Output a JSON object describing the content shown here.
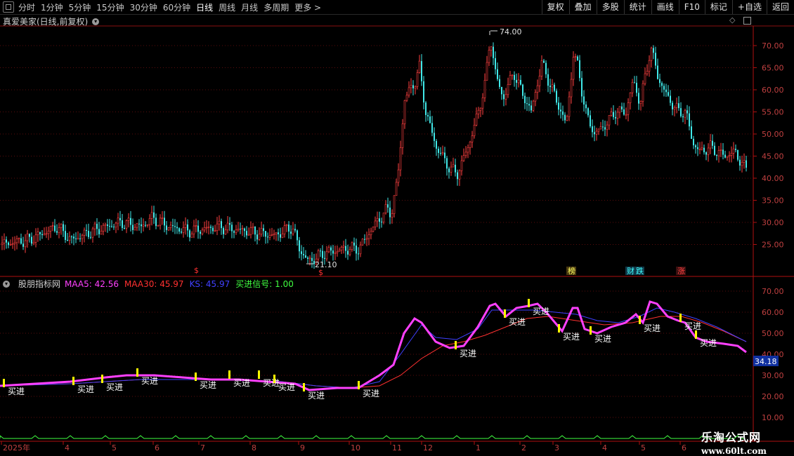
{
  "toolbar": {
    "periods": [
      "分时",
      "1分钟",
      "5分钟",
      "15分钟",
      "30分钟",
      "60分钟",
      "日线",
      "周线",
      "月线",
      "多周期",
      "更多 >"
    ],
    "active_period": "日线",
    "actions": [
      "复权",
      "叠加",
      "多股",
      "统计",
      "画线",
      "F10",
      "标记",
      "+自选",
      "返回"
    ]
  },
  "chart": {
    "title": "真爱美家(日线,前复权)",
    "high_label": "74.00",
    "low_label": "21.10",
    "price_ticks": [
      "70.00",
      "65.00",
      "60.00",
      "55.00",
      "50.00",
      "45.00",
      "40.00",
      "35.00",
      "30.00",
      "25.00"
    ],
    "badges": [
      "$",
      "$",
      "榜",
      "财",
      "跌",
      "涨"
    ]
  },
  "indicator": {
    "name": "股朋指标网",
    "maa5_label": "MAA5: 42.56",
    "maa30_label": "MAA30: 45.97",
    "ks_label": "KS: 45.97",
    "signal_label": "买进信号: 1.00",
    "ticks": [
      "70.00",
      "60.00",
      "50.00",
      "40.00",
      "30.00",
      "20.00",
      "10.00"
    ],
    "current_value": "34.18",
    "signal_text": "买进",
    "colors": {
      "maa5": "#ff40ff",
      "maa30": "#ff3030",
      "ks": "#4040ff",
      "signal": "#40ff40"
    }
  },
  "xaxis": {
    "labels": [
      "2025年",
      "4",
      "5",
      "6",
      "7",
      "8",
      "9",
      "10",
      "11",
      "12",
      "1",
      "2",
      "3",
      "4",
      "5",
      "6"
    ]
  },
  "watermark": {
    "line1": "乐淘公式网",
    "line2": "www.60lt.com"
  }
}
